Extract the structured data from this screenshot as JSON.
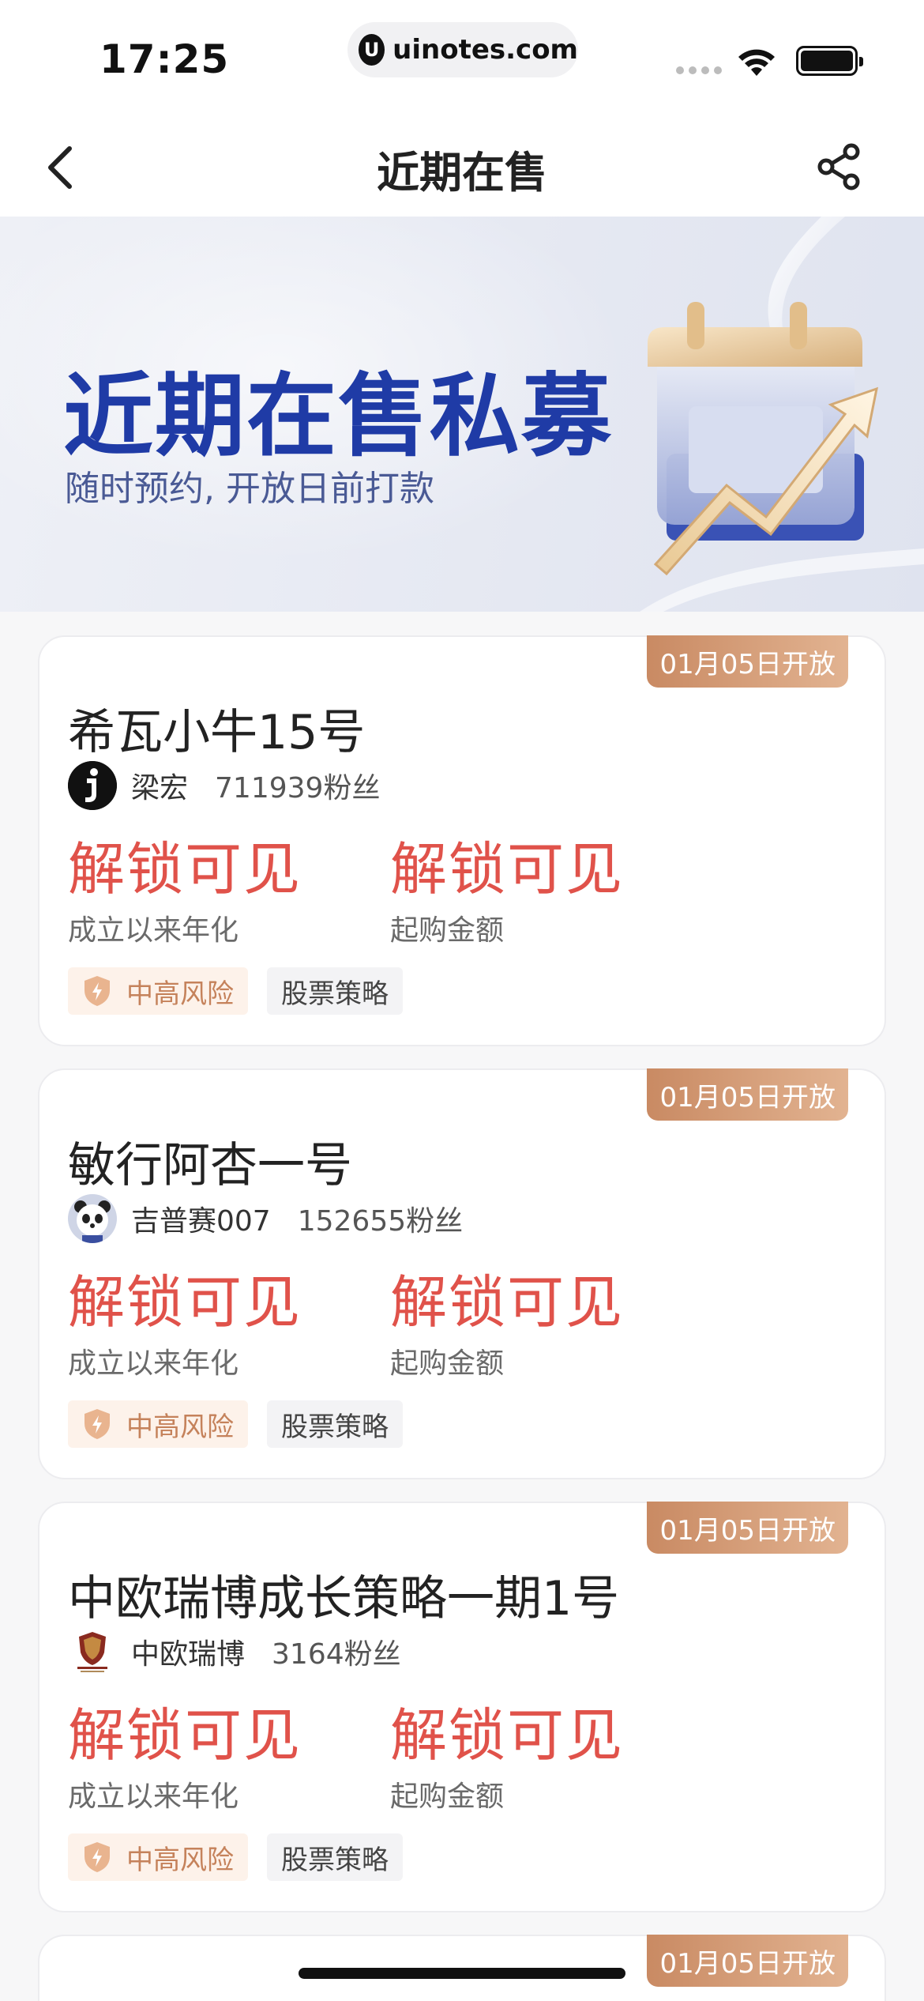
{
  "status_bar": {
    "time": "17:25",
    "url": "uinotes.com",
    "logo_letter": "U"
  },
  "nav": {
    "title": "近期在售",
    "back_icon": "chevron-left-icon",
    "share_icon": "share-icon"
  },
  "banner": {
    "title": "近期在售私募",
    "subtitle": "随时预约, 开放日前打款"
  },
  "colors": {
    "accent_red": "#e0524a",
    "banner_blue": "#1f3ba6",
    "badge_bronze": "#c98a63"
  },
  "funds": [
    {
      "open_badge": "01月05日开放",
      "name": "希瓦小牛15号",
      "manager": "梁宏",
      "fans": "711939粉丝",
      "return_value": "解锁可见",
      "return_label": "成立以来年化",
      "amount_value": "解锁可见",
      "amount_label": "起购金额",
      "risk_tag": "中高风险",
      "strategy_tag": "股票策略"
    },
    {
      "open_badge": "01月05日开放",
      "name": "敏行阿杏一号",
      "manager": "吉普赛007",
      "fans": "152655粉丝",
      "return_value": "解锁可见",
      "return_label": "成立以来年化",
      "amount_value": "解锁可见",
      "amount_label": "起购金额",
      "risk_tag": "中高风险",
      "strategy_tag": "股票策略"
    },
    {
      "open_badge": "01月05日开放",
      "name": "中欧瑞博成长策略一期1号",
      "manager": "中欧瑞博",
      "fans": "3164粉丝",
      "return_value": "解锁可见",
      "return_label": "成立以来年化",
      "amount_value": "解锁可见",
      "amount_label": "起购金额",
      "risk_tag": "中高风险",
      "strategy_tag": "股票策略"
    },
    {
      "open_badge": "01月05日开放"
    }
  ]
}
